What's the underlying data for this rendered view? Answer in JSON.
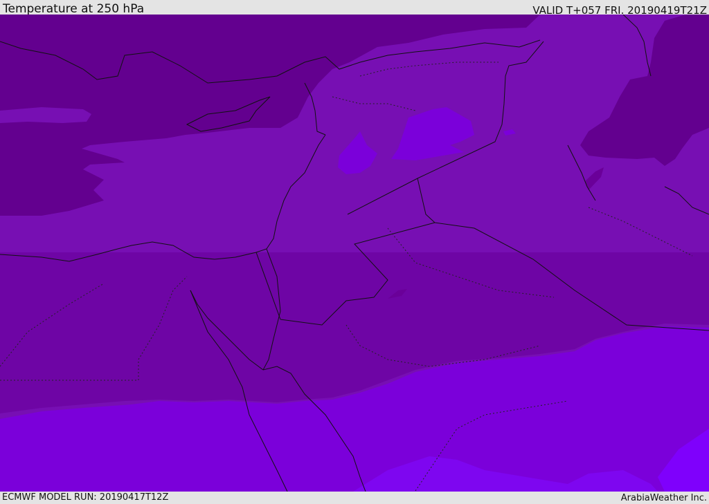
{
  "header": {
    "title": "Temperature at 250 hPa",
    "valid": "VALID T+057 FRI. 20190419T21Z"
  },
  "footer": {
    "model_run": "ECMWF MODEL RUN: 20190417T12Z",
    "credit": "ArabiaWeather Inc."
  },
  "map": {
    "field": "temperature",
    "level": "250 hPa",
    "colors": {
      "darkest": "#63008f",
      "dark": "#6e05a5",
      "mid": "#770fb3",
      "light": "#7b00da",
      "lighter": "#7e06f0",
      "brightest": "#7f00fc",
      "coast": "#111111",
      "border": "#111111"
    }
  }
}
